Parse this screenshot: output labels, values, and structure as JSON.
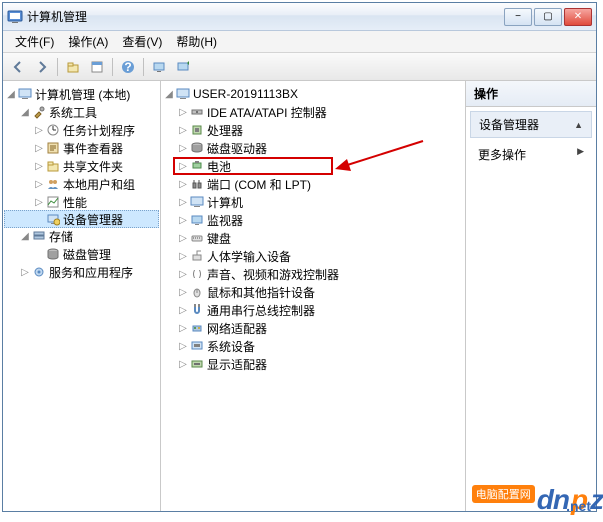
{
  "window": {
    "title": "计算机管理"
  },
  "menubar": {
    "items": [
      "文件(F)",
      "操作(A)",
      "查看(V)",
      "帮助(H)"
    ]
  },
  "left_tree": {
    "root": "计算机管理 (本地)",
    "groups": [
      {
        "label": "系统工具",
        "children": [
          "任务计划程序",
          "事件查看器",
          "共享文件夹",
          "本地用户和组",
          "性能",
          "设备管理器"
        ],
        "selected_index": 5
      },
      {
        "label": "存储",
        "children": [
          "磁盘管理"
        ]
      },
      {
        "label": "服务和应用程序",
        "children": []
      }
    ]
  },
  "mid_tree": {
    "root": "USER-20191113BX",
    "devices": [
      "IDE ATA/ATAPI 控制器",
      "处理器",
      "磁盘驱动器",
      "电池",
      "端口 (COM 和 LPT)",
      "计算机",
      "监视器",
      "键盘",
      "人体学输入设备",
      "声音、视频和游戏控制器",
      "鼠标和其他指针设备",
      "通用串行总线控制器",
      "网络适配器",
      "系统设备",
      "显示适配器"
    ],
    "highlighted_index": 4
  },
  "right_pane": {
    "header": "操作",
    "section": "设备管理器",
    "item": "更多操作"
  },
  "watermark": {
    "dn": "dn",
    "p": "p",
    "z": "z",
    "badge": "电脑配置网",
    "net": ".net"
  }
}
